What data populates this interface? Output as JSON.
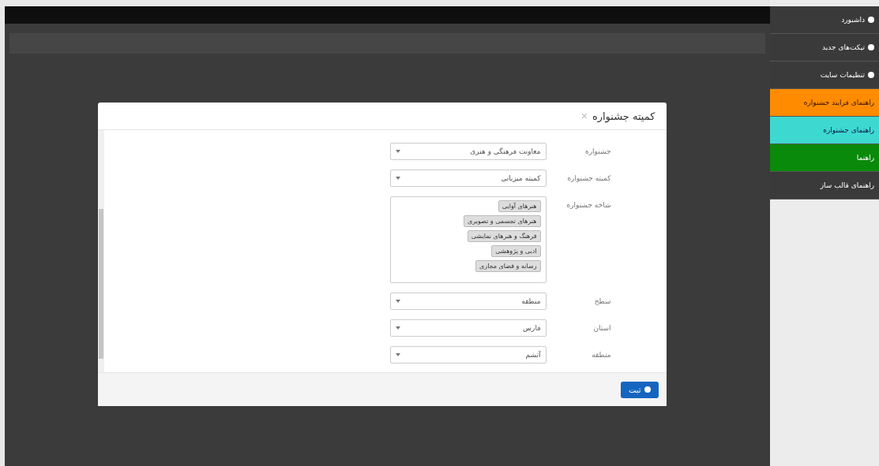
{
  "sidebar": {
    "items": [
      {
        "label": "داشبورد",
        "kind": "icon",
        "color": "#3a3a3a"
      },
      {
        "label": "تیکت‌های جدید",
        "kind": "icon",
        "color": "#3a3a3a"
      },
      {
        "label": "تنظیمات سایت",
        "kind": "icon",
        "color": "#3a3a3a"
      },
      {
        "label": "راهنمای فرایند جشنواره",
        "kind": "plain",
        "color": "#ff8c00"
      },
      {
        "label": "راهنمای جشنواره",
        "kind": "plain",
        "color": "#3dd9d0"
      },
      {
        "label": "راهنما",
        "kind": "plain",
        "color": "#0a8a0a"
      },
      {
        "label": "راهنمای قالب ساز",
        "kind": "plain",
        "color": "#3a3a3a"
      }
    ]
  },
  "modal": {
    "title": "کمیته جشنواره",
    "close": "×",
    "fields": [
      {
        "label": "جشنواره",
        "kind": "select",
        "value": "معاونت فرهنگی و هنری"
      },
      {
        "label": "کمیته جشنواره",
        "kind": "select",
        "value": "کمیته میزبانی"
      },
      {
        "label": "شاخه جشنواره",
        "kind": "tags",
        "tags": [
          "هنرهای آوایی",
          "هنرهای تجسمی و تصویری",
          "فرهنگ و هنرهای نمایشی",
          "ادبی و پژوهشی",
          "رسانه و فضای مجازی"
        ]
      },
      {
        "label": "سطح",
        "kind": "select",
        "value": "منطقه"
      },
      {
        "label": "استان",
        "kind": "select",
        "value": "فارس"
      },
      {
        "label": "منطقه",
        "kind": "select",
        "value": "آتشم"
      }
    ],
    "submit": "ثبت"
  }
}
